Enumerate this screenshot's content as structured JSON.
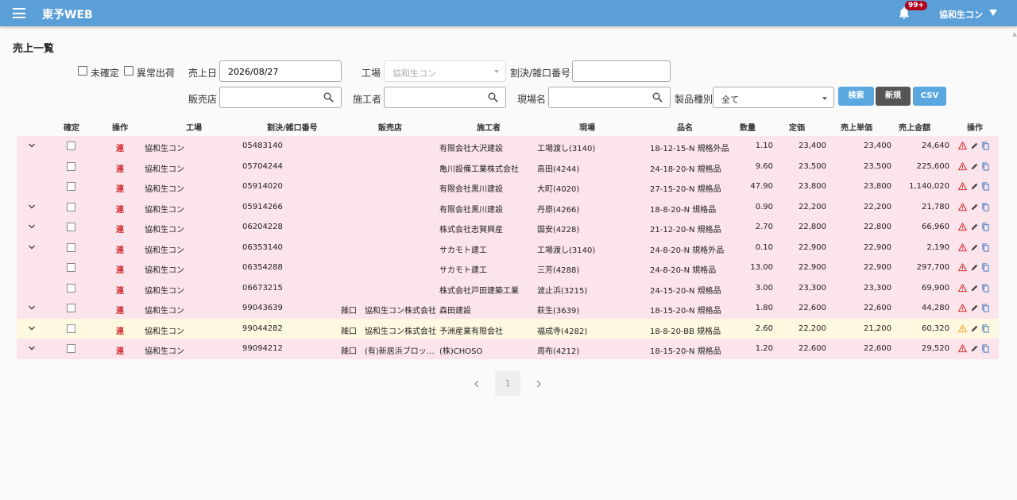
{
  "app": {
    "title": "東予WEB",
    "badge": "99+",
    "user": "協和生コン"
  },
  "page": {
    "title": "売上一覧"
  },
  "filters": {
    "unconfirmed_label": "未確定",
    "abnormal_label": "異常出荷",
    "sale_date_label": "売上日",
    "sale_date_value": "2026/08/27",
    "factory_label": "工場",
    "factory_value": "協和生コン",
    "ticket_label": "割決/雑口番号",
    "ticket_value": "",
    "dealer_label": "販売店",
    "builder_label": "施工者",
    "site_label": "現場名",
    "product_label": "製品種別",
    "product_value": "全て"
  },
  "buttons": {
    "search": "検索",
    "new": "新規",
    "csv": "CSV"
  },
  "colors": {
    "header": "#5b9fd8",
    "pink_row": "#fce4ec",
    "yellow_row": "#fff8e1",
    "search_btn": "#5ba8e0",
    "new_btn": "#555555",
    "csv_btn": "#5ba8e0",
    "ren_red": "#d32f2f",
    "warn_red": "#d32f2f",
    "warn_orange": "#f9a825"
  },
  "table": {
    "headers": [
      "確定",
      "操作",
      "工場",
      "割決/雑口番号",
      "販売店",
      "施工者",
      "現場",
      "品名",
      "数量",
      "定価",
      "売上単価",
      "売上金額",
      "操作"
    ],
    "ren_label": "連",
    "rows": [
      {
        "expand": true,
        "factory": "協和生コン",
        "ticket": "05483140",
        "type": "",
        "dealer": "",
        "builder": "有限会社大沢建設",
        "site": "工場渡し(3140)",
        "product": "18-12-15-N 規格外品",
        "qty": "1.10",
        "price": "23,400",
        "unit": "23,400",
        "amount": "24,640",
        "tone": "pink",
        "warn": "red"
      },
      {
        "expand": false,
        "factory": "協和生コン",
        "ticket": "05704244",
        "type": "",
        "dealer": "",
        "builder": "亀川設備工業株式会社",
        "site": "高田(4244)",
        "product": "24-18-20-N 規格品",
        "qty": "9.60",
        "price": "23,500",
        "unit": "23,500",
        "amount": "225,600",
        "tone": "pink",
        "warn": "red"
      },
      {
        "expand": false,
        "factory": "協和生コン",
        "ticket": "05914020",
        "type": "",
        "dealer": "",
        "builder": "有限会社黒川建設",
        "site": "大町(4020)",
        "product": "27-15-20-N 規格品",
        "qty": "47.90",
        "price": "23,800",
        "unit": "23,800",
        "amount": "1,140,020",
        "tone": "pink",
        "warn": "red"
      },
      {
        "expand": true,
        "factory": "協和生コン",
        "ticket": "05914266",
        "type": "",
        "dealer": "",
        "builder": "有限会社黒川建設",
        "site": "丹原(4266)",
        "product": "18-8-20-N 規格品",
        "qty": "0.90",
        "price": "22,200",
        "unit": "22,200",
        "amount": "21,780",
        "tone": "pink",
        "warn": "red"
      },
      {
        "expand": true,
        "factory": "協和生コン",
        "ticket": "06204228",
        "type": "",
        "dealer": "",
        "builder": "株式会社志賀興産",
        "site": "国安(4228)",
        "product": "21-12-20-N 規格品",
        "qty": "2.70",
        "price": "22,800",
        "unit": "22,800",
        "amount": "66,960",
        "tone": "pink",
        "warn": "red"
      },
      {
        "expand": true,
        "factory": "協和生コン",
        "ticket": "06353140",
        "type": "",
        "dealer": "",
        "builder": "サカモト建工",
        "site": "工場渡し(3140)",
        "product": "24-8-20-N 規格外品",
        "qty": "0.10",
        "price": "22,900",
        "unit": "22,900",
        "amount": "2,190",
        "tone": "pink",
        "warn": "red"
      },
      {
        "expand": false,
        "factory": "協和生コン",
        "ticket": "06354288",
        "type": "",
        "dealer": "",
        "builder": "サカモト建工",
        "site": "三芳(4288)",
        "product": "24-8-20-N 規格品",
        "qty": "13.00",
        "price": "22,900",
        "unit": "22,900",
        "amount": "297,700",
        "tone": "pink",
        "warn": "red"
      },
      {
        "expand": false,
        "factory": "協和生コン",
        "ticket": "06673215",
        "type": "",
        "dealer": "",
        "builder": "株式会社戸田建築工業",
        "site": "波止浜(3215)",
        "product": "24-15-20-N 規格品",
        "qty": "3.00",
        "price": "23,300",
        "unit": "23,300",
        "amount": "69,900",
        "tone": "pink",
        "warn": "red"
      },
      {
        "expand": true,
        "factory": "協和生コン",
        "ticket": "99043639",
        "type": "雑口",
        "dealer": "協和生コン株式会社",
        "builder": "森田建設",
        "site": "萩生(3639)",
        "product": "18-15-20-N 規格品",
        "qty": "1.80",
        "price": "22,600",
        "unit": "22,600",
        "amount": "44,280",
        "tone": "pink",
        "warn": "red"
      },
      {
        "expand": true,
        "factory": "協和生コン",
        "ticket": "99044282",
        "type": "雑口",
        "dealer": "協和生コン株式会社",
        "builder": "予洲産業有限会社",
        "site": "福成寺(4282)",
        "product": "18-8-20-BB 規格品",
        "qty": "2.60",
        "price": "22,200",
        "unit": "21,200",
        "amount": "60,320",
        "tone": "yellow",
        "warn": "orange"
      },
      {
        "expand": true,
        "factory": "協和生コン",
        "ticket": "99094212",
        "type": "雑口",
        "dealer": "(有)新居浜ブロッ…",
        "builder": "(株)CHOSO",
        "site": "周布(4212)",
        "product": "18-15-20-N 規格品",
        "qty": "1.20",
        "price": "22,600",
        "unit": "22,600",
        "amount": "29,520",
        "tone": "pink",
        "warn": "red"
      }
    ]
  },
  "pagination": {
    "current": "1",
    "prev_icon": "chevron-left-icon",
    "next_icon": "chevron-right-icon"
  }
}
